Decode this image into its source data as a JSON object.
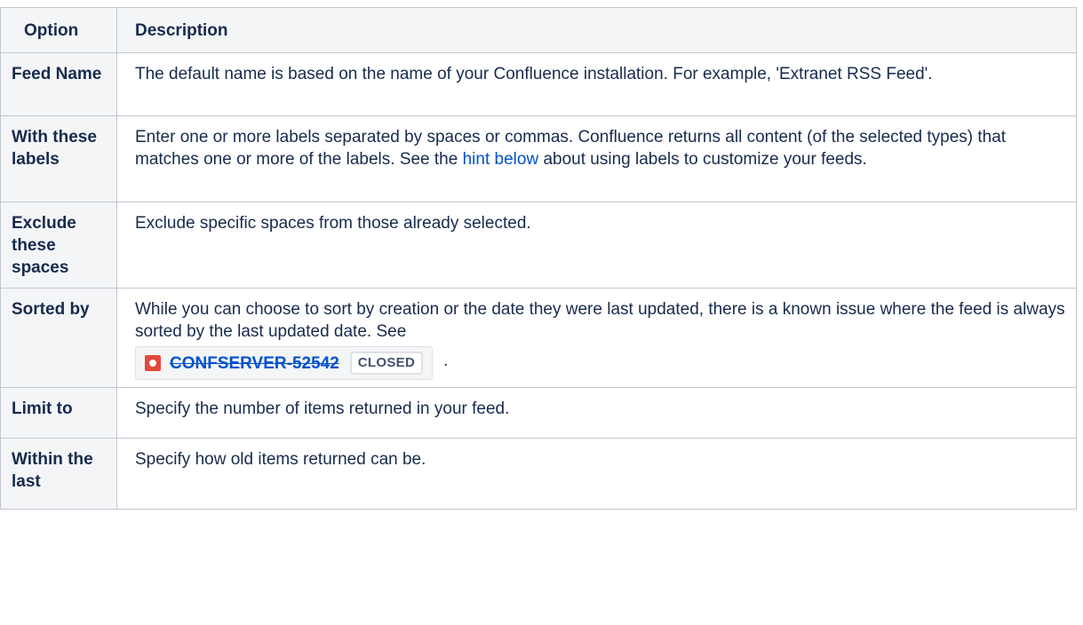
{
  "header": {
    "option": "Option",
    "description": "Description"
  },
  "rows": [
    {
      "option": "Feed Name",
      "description": "The default name is based on the name of your Confluence installation. For example, 'Extranet RSS Feed'."
    },
    {
      "option": "With these labels",
      "description_before": "Enter one or more labels separated by spaces or commas. Confluence returns all content (of the selected types) that matches one or more of the labels. See the ",
      "link_text": "hint below",
      "description_after": " about using labels to customize your feeds."
    },
    {
      "option": "Exclude these spaces",
      "description": "Exclude specific spaces from those already selected."
    },
    {
      "option": "Sorted by",
      "description": "While you can choose to sort by creation or the date they were last updated, there is a known issue where the feed is always sorted by the last updated date. See",
      "issue": {
        "key": "CONFSERVER-52542",
        "status": "CLOSED",
        "icon": "jira-bug-icon"
      },
      "trailing": "."
    },
    {
      "option": "Limit to",
      "description": "Specify the number of items returned in your feed."
    },
    {
      "option": "Within the last",
      "description": "Specify how old items returned can be."
    }
  ],
  "colors": {
    "link": "#0052cc",
    "header_bg": "#f4f5f7",
    "border": "#c1c7d0",
    "bug_icon": "#e5493a"
  }
}
